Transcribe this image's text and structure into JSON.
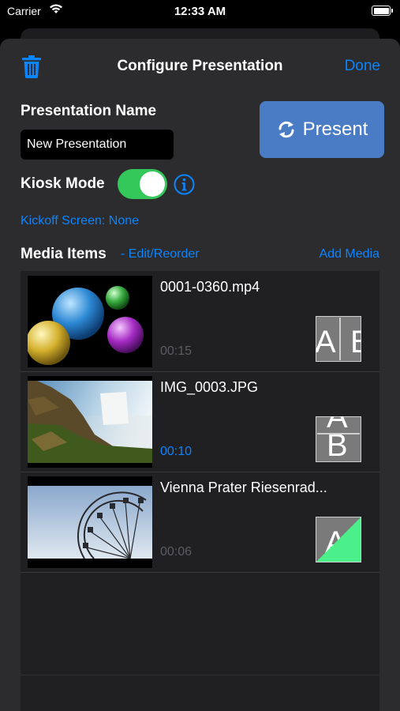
{
  "status_bar": {
    "carrier": "Carrier",
    "time": "12:33 AM"
  },
  "header": {
    "title": "Configure Presentation",
    "done_label": "Done"
  },
  "presentation_name": {
    "label": "Presentation Name",
    "value": "New Presentation"
  },
  "present_button": {
    "label": "Present"
  },
  "kiosk": {
    "label": "Kiosk Mode",
    "enabled": true
  },
  "kickoff_label": "Kickoff Screen: None",
  "media": {
    "title": "Media Items",
    "edit_label": "- Edit/Reorder",
    "add_label": "Add Media",
    "items": [
      {
        "name": "0001-0360.mp4",
        "duration": "00:15",
        "duration_active": false,
        "thumbnail": "colored-spheres",
        "transition": "slide-horizontal"
      },
      {
        "name": "IMG_0003.JPG",
        "duration": "00:10",
        "duration_active": true,
        "thumbnail": "waterfall",
        "transition": "slide-vertical"
      },
      {
        "name": "Vienna Prater Riesenrad...",
        "duration": "00:06",
        "duration_active": false,
        "thumbnail": "ferris-wheel",
        "transition": "wipe-diagonal"
      }
    ]
  },
  "colors": {
    "accent": "#0a84ff",
    "present_button": "#4a7cc6",
    "toggle_on": "#34c759",
    "sheet_bg": "#2c2c2e"
  }
}
